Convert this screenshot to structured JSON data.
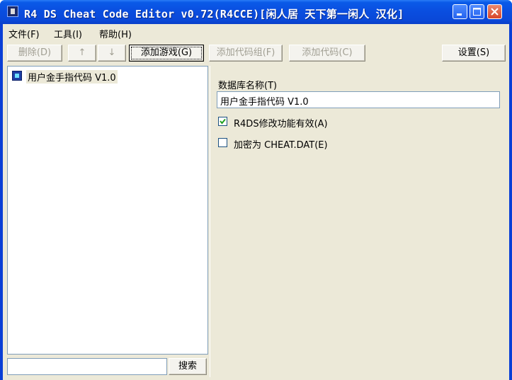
{
  "window": {
    "title": "R4 DS Cheat Code Editor v0.72(R4CCE)[闲人居 天下第一闲人 汉化]"
  },
  "menu": {
    "items": [
      {
        "label": "文件(F)"
      },
      {
        "label": "工具(I)"
      },
      {
        "label": "帮助(H)"
      }
    ]
  },
  "toolbar": {
    "delete_label": "删除(D)",
    "up_label": "↑",
    "down_label": "↓",
    "add_game_label": "添加游戏(G)",
    "add_code_group_label": "添加代码组(F)",
    "add_code_label": "添加代码(C)",
    "settings_label": "设置(S)"
  },
  "tree": {
    "items": [
      {
        "label": "用户金手指代码 V1.0",
        "icon": "database-icon",
        "selected": true
      }
    ]
  },
  "search": {
    "value": "",
    "button_label": "搜索"
  },
  "details": {
    "db_name_label": "数据库名称(T)",
    "db_name_value": "用户金手指代码 V1.0",
    "enable_label": "R4DS修改功能有效(A)",
    "enable_checked": true,
    "encrypt_label": "加密为 CHEAT.DAT(E)",
    "encrypt_checked": false
  },
  "colors": {
    "titlebar": "#0a4ee0",
    "client_bg": "#ece9d8",
    "disabled_text": "#a19f93"
  }
}
